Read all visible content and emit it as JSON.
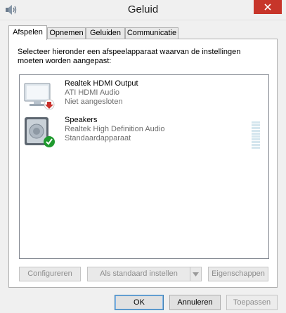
{
  "window": {
    "title": "Geluid"
  },
  "tabs": [
    {
      "label": "Afspelen",
      "active": true
    },
    {
      "label": "Opnemen",
      "active": false
    },
    {
      "label": "Geluiden",
      "active": false
    },
    {
      "label": "Communicatie",
      "active": false
    }
  ],
  "playback": {
    "instructions": "Selecteer hieronder een afspeelapparaat waarvan de instellingen\nmoeten worden aangepast:",
    "devices": [
      {
        "name": "Realtek HDMI Output",
        "driver": "ATI HDMI Audio",
        "status": "Niet aangesloten",
        "icon": "monitor-speaker-icon",
        "badge": "disconnected-badge-icon"
      },
      {
        "name": "Speakers",
        "driver": "Realtek High Definition Audio",
        "status": "Standaardapparaat",
        "icon": "speaker-icon",
        "badge": "default-check-icon"
      }
    ],
    "buttons": {
      "configure": "Configureren",
      "set_default": "Als standaard instellen",
      "properties": "Eigenschappen"
    }
  },
  "dialog_buttons": {
    "ok": "OK",
    "cancel": "Annuleren",
    "apply": "Toepassen"
  },
  "colors": {
    "close": "#c7352a",
    "check": "#1f9a2e",
    "disconnected": "#c8302b",
    "meter": "#d5e6ee"
  }
}
